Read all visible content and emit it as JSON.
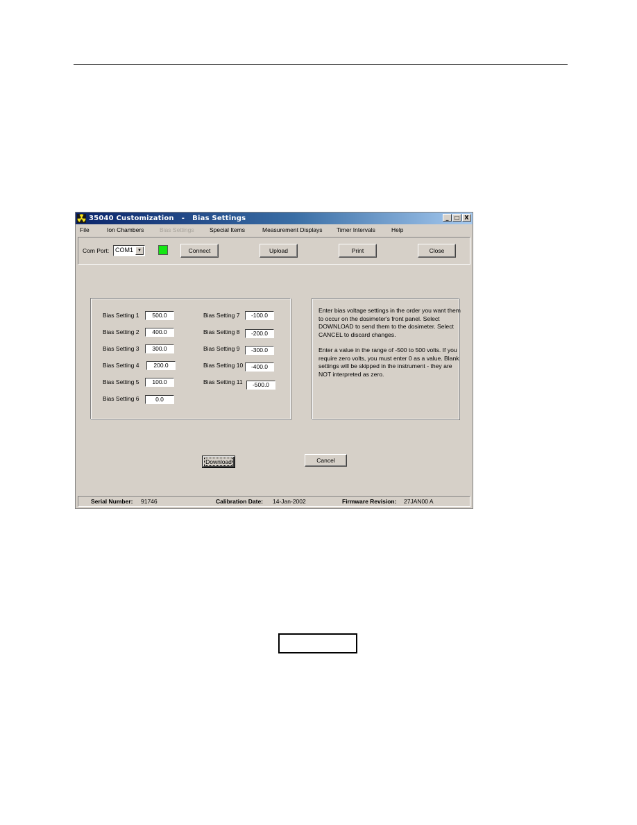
{
  "window": {
    "title": "35040 Customization   -   Bias Settings",
    "caption_buttons": {
      "minimize": "_",
      "maximize": "□",
      "close": "X"
    }
  },
  "menu": [
    {
      "label": "File",
      "enabled": true
    },
    {
      "label": "Ion Chambers",
      "enabled": true
    },
    {
      "label": "Bias Settings",
      "enabled": false
    },
    {
      "label": "Special Items",
      "enabled": true
    },
    {
      "label": "Measurement Displays",
      "enabled": true
    },
    {
      "label": "Timer Intervals",
      "enabled": true
    },
    {
      "label": "Help",
      "enabled": true
    }
  ],
  "toolbar": {
    "com_port_label": "Com Port:",
    "com_port_value": "COM1",
    "connection_status_color": "#14e614",
    "connect_label": "Connect",
    "upload_label": "Upload",
    "print_label": "Print",
    "close_label": "Close"
  },
  "bias_settings": [
    {
      "label": "Bias Setting 1",
      "value": "500.0"
    },
    {
      "label": "Bias Setting 2",
      "value": "400.0"
    },
    {
      "label": "Bias Setting 3",
      "value": "300.0"
    },
    {
      "label": "Bias Setting 4",
      "value": "200.0"
    },
    {
      "label": "Bias Setting 5",
      "value": "100.0"
    },
    {
      "label": "Bias Setting 6",
      "value": "0.0"
    },
    {
      "label": "Bias Setting 7",
      "value": "-100.0"
    },
    {
      "label": "Bias Setting 8",
      "value": "-200.0"
    },
    {
      "label": "Bias Setting 9",
      "value": "-300.0"
    },
    {
      "label": "Bias Setting 10",
      "value": "-400.0"
    },
    {
      "label": "Bias Setting 11",
      "value": "-500.0"
    }
  ],
  "help": {
    "paragraph1": "Enter bias voltage settings in the order you want them to occur on the dosimeter's front panel.  Select DOWNLOAD to send them to the dosimeter.  Select CANCEL to discard changes.",
    "paragraph2": "Enter a value in the range of -500 to 500 volts.  If you require zero volts, you must enter 0 as a value.  Blank settings will be skipped in the instrument - they are NOT interpreted as zero."
  },
  "actions": {
    "download_label": "Download",
    "cancel_label": "Cancel"
  },
  "status": {
    "serial_label": "Serial Number:",
    "serial_value": "91746",
    "calibration_label": "Calibration Date:",
    "calibration_value": "14-Jan-2002",
    "firmware_label": "Firmware Revision:",
    "firmware_value": "27JAN00 A"
  }
}
